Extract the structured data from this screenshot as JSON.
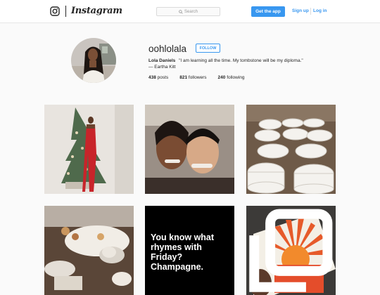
{
  "app": {
    "name": "Instagram"
  },
  "header": {
    "search_placeholder": "Search",
    "get_app_label": "Get the app",
    "signup_label": "Sign up",
    "login_label": "Log in"
  },
  "profile": {
    "username": "oohlolala",
    "follow_label": "FOLLOW",
    "full_name": "Lola Daniels",
    "bio": "\"I am learning all the time. My tombstone will be my diploma.\" — Eartha Kitt",
    "posts_count": "438",
    "posts_label": "posts",
    "followers_count": "821",
    "followers_label": "followers",
    "following_count": "240",
    "following_label": "following"
  },
  "grid": {
    "tiles": [
      {
        "subject": "woman-red-dress-christmas-tree"
      },
      {
        "subject": "couple-selfie"
      },
      {
        "subject": "stacked-white-bowls"
      },
      {
        "subject": "afternoon-tea-table"
      },
      {
        "subject": "text-card",
        "lines": [
          "You know what",
          "rhymes with Friday?",
          "Champagne."
        ]
      },
      {
        "subject": "sunburst-artwork",
        "icon": "multi-post-icon"
      }
    ]
  },
  "colors": {
    "accent": "#3897f0",
    "background": "#fafafa",
    "border": "#dbdbdb"
  }
}
